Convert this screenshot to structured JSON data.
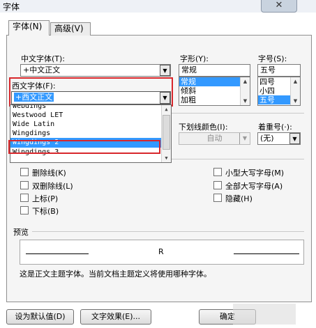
{
  "window": {
    "title": "字体",
    "close_glyph": "✕"
  },
  "tabs": [
    {
      "label": "字体(N)",
      "active": true
    },
    {
      "label": "高级(V)",
      "active": false
    }
  ],
  "chinese_font": {
    "label": "中文字体(T):",
    "value": "+中文正文"
  },
  "western_font": {
    "label": "西文字体(F):",
    "value": "+西文正文",
    "options": [
      "Webdings",
      "Westwood LET",
      "Wide Latin",
      "Wingdings",
      "Wingdings 2",
      "Wingdings 3"
    ],
    "selected": "Wingdings 2"
  },
  "style": {
    "label": "字形(Y):",
    "value": "常规",
    "options": [
      "常规",
      "倾斜",
      "加粗"
    ],
    "selected": "常规"
  },
  "size": {
    "label": "字号(S):",
    "value": "五号",
    "options": [
      "四号",
      "小四",
      "五号"
    ],
    "selected": "五号"
  },
  "underline_color": {
    "label": "下划线颜色(I):",
    "value": "自动"
  },
  "emphasis": {
    "label": "着重号(·):",
    "value": "(无)"
  },
  "partial_labels": {
    "all_text": "所",
    "effects": "效"
  },
  "effects": {
    "left": [
      "删除线(K)",
      "双删除线(L)",
      "上标(P)",
      "下标(B)"
    ],
    "right": [
      "小型大写字母(M)",
      "全部大写字母(A)",
      "隐藏(H)"
    ]
  },
  "preview": {
    "label": "预览",
    "sample": "R",
    "note": "这是正文主题字体。当前文档主题定义将使用哪种字体。"
  },
  "buttons": {
    "set_default": "设为默认值(D)",
    "text_effects": "文字效果(E)...",
    "ok": "确定"
  },
  "colors": {
    "selection": "#3399ff",
    "highlight": "#d8262b"
  }
}
